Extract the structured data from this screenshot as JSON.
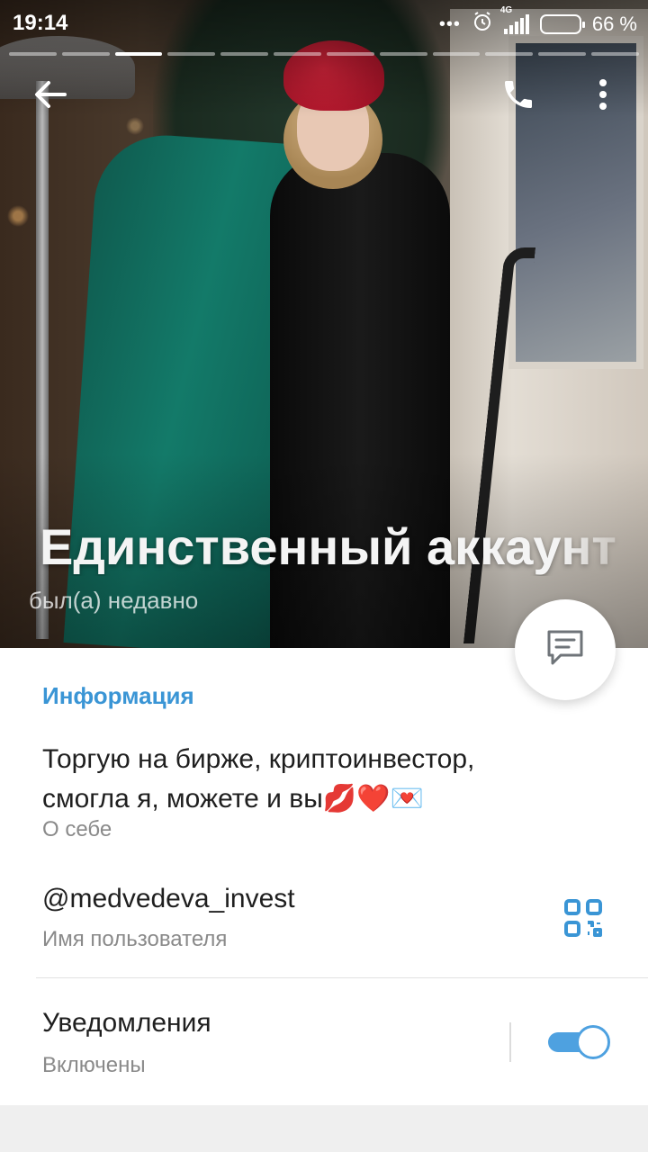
{
  "status_bar": {
    "time": "19:14",
    "dots": "•••",
    "network": "4G",
    "battery_percent": 66,
    "battery_text": "66 %"
  },
  "stories": {
    "segment_count": 12,
    "active_index": 2
  },
  "profile": {
    "name": "Единственный аккаунт",
    "status": "был(а) недавно"
  },
  "info": {
    "section_title": "Информация",
    "bio_line1": "Торгую на бирже, криптоинвестор,",
    "bio_line2": "смогла я, можете и вы💋❤️💌",
    "bio_label": "О себе",
    "username": "@medvedeva_invest",
    "username_label": "Имя пользователя",
    "notifications_title": "Уведомления",
    "notifications_state": "Включены",
    "notifications_on": true
  },
  "colors": {
    "accent": "#3a95d5",
    "toggle": "#4ea1e0"
  },
  "icons": {
    "back": "arrow-left-icon",
    "call": "phone-icon",
    "more": "more-vertical-icon",
    "message": "message-icon",
    "qr": "qr-code-icon"
  }
}
